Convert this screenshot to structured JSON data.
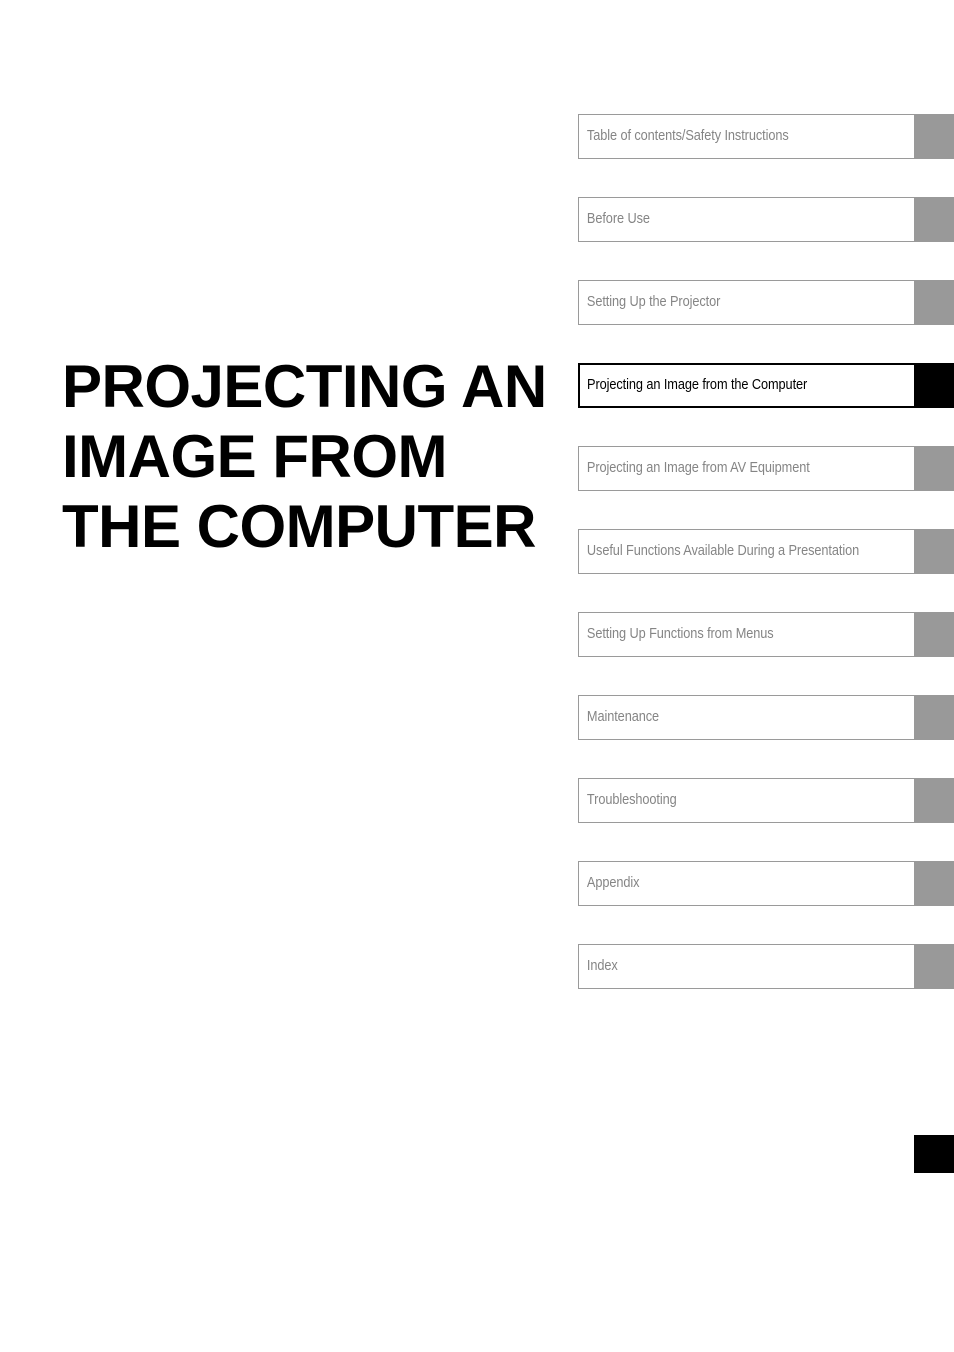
{
  "page": {
    "chapter_title_lines": [
      "PROJECTING AN",
      "IMAGE FROM",
      "THE COMPUTER"
    ],
    "chapter_title_full": "PROJECTING AN IMAGE FROM THE COMPUTER"
  },
  "colors": {
    "marker_inactive": "#999999",
    "marker_active": "#000000",
    "label_inactive": "#858585",
    "label_active": "#000000",
    "border_inactive": "#9a9a9a",
    "border_active": "#000000",
    "page_background": "#ffffff"
  },
  "chapter_tabs": {
    "items": [
      {
        "label": "Table of contents/Safety Instructions",
        "active": false
      },
      {
        "label": "Before Use",
        "active": false
      },
      {
        "label": "Setting Up the Projector",
        "active": false
      },
      {
        "label": "Projecting an Image from the Computer",
        "active": true
      },
      {
        "label": "Projecting an Image from AV Equipment",
        "active": false
      },
      {
        "label": "Useful Functions Available During a Presentation",
        "active": false
      },
      {
        "label": "Setting Up Functions from Menus",
        "active": false
      },
      {
        "label": "Maintenance",
        "active": false
      },
      {
        "label": "Troubleshooting",
        "active": false
      },
      {
        "label": "Appendix",
        "active": false
      },
      {
        "label": "Index",
        "active": false
      }
    ]
  },
  "page_edge_marker": {
    "name": "page-edge-thumb-marker"
  }
}
